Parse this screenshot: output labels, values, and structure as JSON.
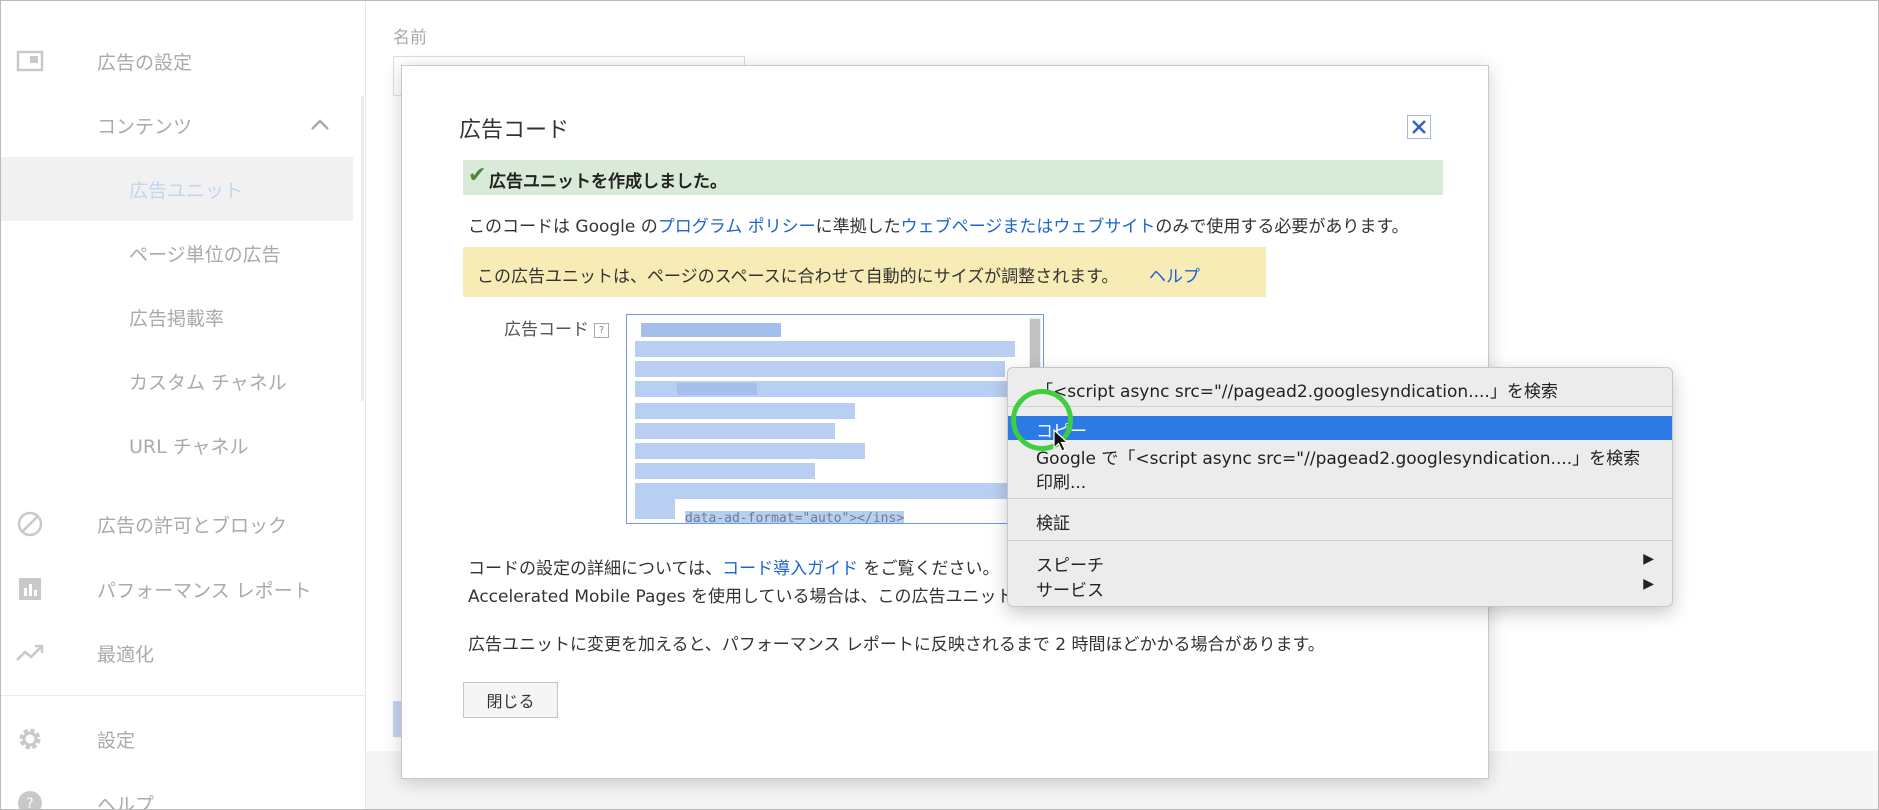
{
  "sidebar": {
    "items": [
      {
        "label": "広告の設定",
        "icon": "ad-settings-icon"
      },
      {
        "label": "コンテンツ",
        "icon": "chevron-up-icon"
      },
      {
        "label": "広告ユニット"
      },
      {
        "label": "ページ単位の広告"
      },
      {
        "label": "広告掲載率"
      },
      {
        "label": "カスタム チャネル"
      },
      {
        "label": "URL チャネル"
      },
      {
        "label": "広告の許可とブロック",
        "icon": "block-icon"
      },
      {
        "label": "パフォーマンス レポート",
        "icon": "bar-chart-icon"
      },
      {
        "label": "最適化",
        "icon": "trending-up-icon"
      },
      {
        "label": "設定",
        "icon": "gear-icon"
      },
      {
        "label": "ヘルプ",
        "icon": "help-icon"
      }
    ]
  },
  "background": {
    "name_label": "名前"
  },
  "dialog": {
    "title": "広告コード",
    "success_message": "広告ユニットを作成しました。",
    "policy_prefix": "このコードは Google の",
    "policy_link1": "プログラム ポリシー",
    "policy_middle": "に準拠した",
    "policy_link2": "ウェブページまたはウェブサイト",
    "policy_suffix": "のみで使用する必要があります。",
    "warning_text": "この広告ユニットは、ページのスペースに合わせて自動的にサイズが調整されます。",
    "warning_help": "ヘルプ",
    "code_label": "広告コード",
    "code_help_glyph": "?",
    "code_tail": "data-ad-format=\"auto\"></ins>",
    "para1_prefix": "コードの設定の詳細については、",
    "para1_link": "コード導入ガイド",
    "para1_suffix": " をご覧ください。",
    "para2": "Accelerated Mobile Pages を使用している場合は、この広告ユニット",
    "para3": "広告ユニットに変更を加えると、パフォーマンス レポートに反映されるまで 2 時間ほどかかる場合があります。",
    "close_button": "閉じる"
  },
  "context_menu": {
    "items": [
      {
        "label": "「<script async src=\"//pagead2.googlesyndication....」を検索"
      },
      {
        "label": "コピー",
        "selected": true
      },
      {
        "label": "Google で「<script async src=\"//pagead2.googlesyndication....」を検索"
      },
      {
        "label": "印刷..."
      },
      {
        "label": "検証"
      },
      {
        "label": "スピーチ",
        "submenu": true
      },
      {
        "label": "サービス",
        "submenu": true
      }
    ],
    "submenu_arrow": "▶"
  },
  "colors": {
    "accent": "#2c7be5",
    "link": "#1a65d4",
    "success_bg": "#d9ead9",
    "warning_bg": "#f7ecb5",
    "highlight_ring": "#3fce3f"
  }
}
